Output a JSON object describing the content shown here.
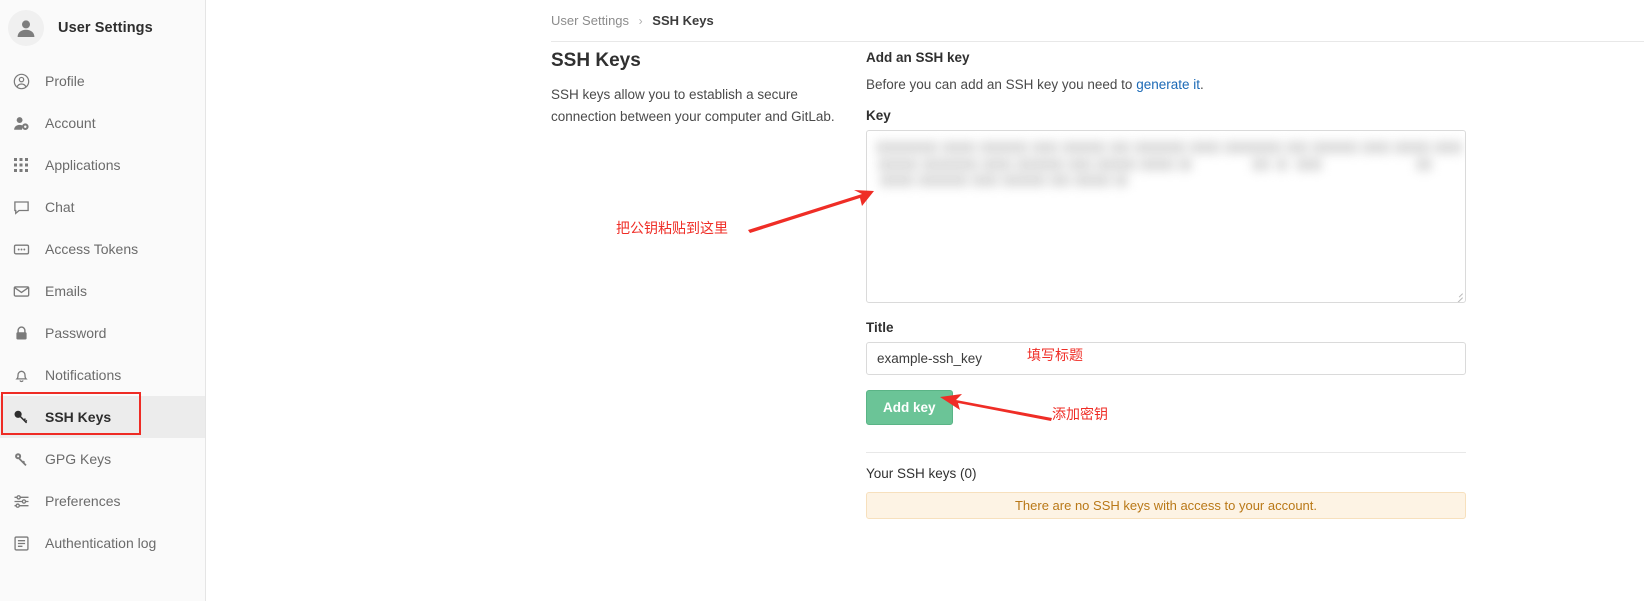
{
  "sidebar": {
    "title": "User Settings",
    "avatar_icon": "user-avatar-icon",
    "items": [
      {
        "label": "Profile",
        "icon": "user-circle-icon",
        "active": false
      },
      {
        "label": "Account",
        "icon": "user-gear-icon",
        "active": false
      },
      {
        "label": "Applications",
        "icon": "grid-dots-icon",
        "active": false
      },
      {
        "label": "Chat",
        "icon": "chat-bubble-icon",
        "active": false
      },
      {
        "label": "Access Tokens",
        "icon": "token-card-icon",
        "active": false
      },
      {
        "label": "Emails",
        "icon": "envelope-icon",
        "active": false
      },
      {
        "label": "Password",
        "icon": "lock-icon",
        "active": false
      },
      {
        "label": "Notifications",
        "icon": "bell-icon",
        "active": false
      },
      {
        "label": "SSH Keys",
        "icon": "key-icon",
        "active": true
      },
      {
        "label": "GPG Keys",
        "icon": "key-icon",
        "active": false
      },
      {
        "label": "Preferences",
        "icon": "sliders-icon",
        "active": false
      },
      {
        "label": "Authentication log",
        "icon": "log-list-icon",
        "active": false
      }
    ]
  },
  "breadcrumb": {
    "parent": "User Settings",
    "separator": "›",
    "current": "SSH Keys"
  },
  "left_panel": {
    "heading": "SSH Keys",
    "description": "SSH keys allow you to establish a secure connection between your computer and GitLab."
  },
  "form": {
    "heading": "Add an SSH key",
    "subtitle_before": "Before you can add an SSH key you need to ",
    "subtitle_link": "generate it",
    "subtitle_after": ".",
    "key_label": "Key",
    "key_value": "",
    "key_obscured": true,
    "title_label": "Title",
    "title_value": "example-ssh_key",
    "title_placeholder": "",
    "submit_label": "Add key"
  },
  "keys_list": {
    "heading": "Your SSH keys (0)",
    "count": 0,
    "empty_message": "There are no SSH keys with access to your account."
  },
  "annotations": {
    "color": "#ef2d26",
    "paste_key_here": "把公钥粘贴到这里",
    "fill_title": "填写标题",
    "add_key": "添加密钥"
  },
  "colors": {
    "sidebar_bg": "#fafafa",
    "active_item_bg": "#ececec",
    "link": "#1b69b6",
    "button_green": "#6bc497",
    "alert_bg": "#fdf3e4",
    "alert_text": "#b97817",
    "annotation_red": "#ef2d26"
  }
}
